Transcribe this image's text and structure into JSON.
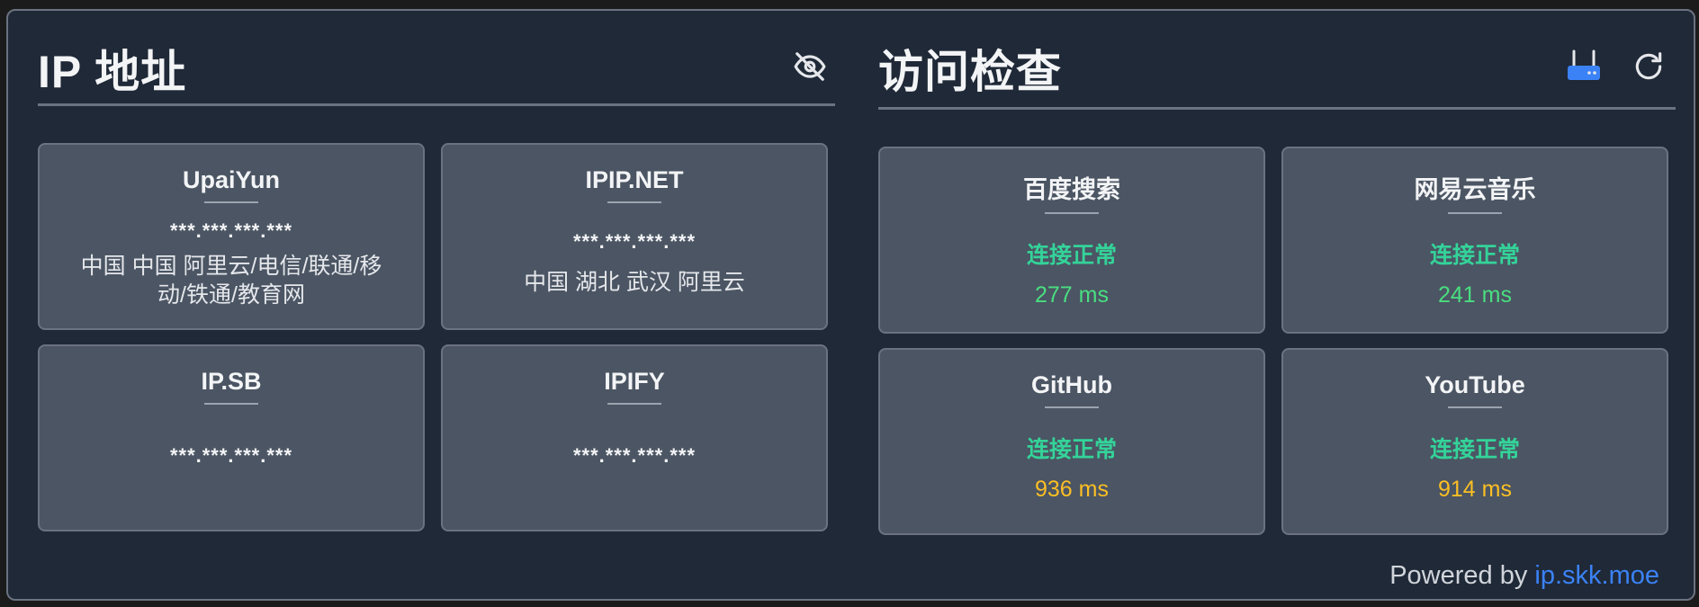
{
  "ip_section": {
    "title": "IP 地址",
    "cards": [
      {
        "name": "UpaiYun",
        "ip": "***.***.***.***",
        "location": "中国 中国 阿里云/电信/联通/移动/铁通/教育网"
      },
      {
        "name": "IPIP.NET",
        "ip": "***.***.***.***",
        "location": "中国 湖北 武汉 阿里云"
      },
      {
        "name": "IP.SB",
        "ip": "***.***.***.***",
        "location": ""
      },
      {
        "name": "IPIFY",
        "ip": "***.***.***.***",
        "location": ""
      }
    ]
  },
  "access_section": {
    "title": "访问检查",
    "cards": [
      {
        "name": "百度搜索",
        "status": "连接正常",
        "latency": "277 ms",
        "latency_color": "#4ade80"
      },
      {
        "name": "网易云音乐",
        "status": "连接正常",
        "latency": "241 ms",
        "latency_color": "#4ade80"
      },
      {
        "name": "GitHub",
        "status": "连接正常",
        "latency": "936 ms",
        "latency_color": "#fbbf24"
      },
      {
        "name": "YouTube",
        "status": "连接正常",
        "latency": "914 ms",
        "latency_color": "#fbbf24"
      }
    ]
  },
  "footer": {
    "prefix": "Powered by ",
    "link_text": "ip.skk.moe"
  },
  "icons": {
    "hide": "eye-off-icon",
    "router": "router-icon",
    "refresh": "refresh-icon"
  },
  "colors": {
    "status_ok": "#34d399",
    "accent_blue": "#3b82f6"
  }
}
